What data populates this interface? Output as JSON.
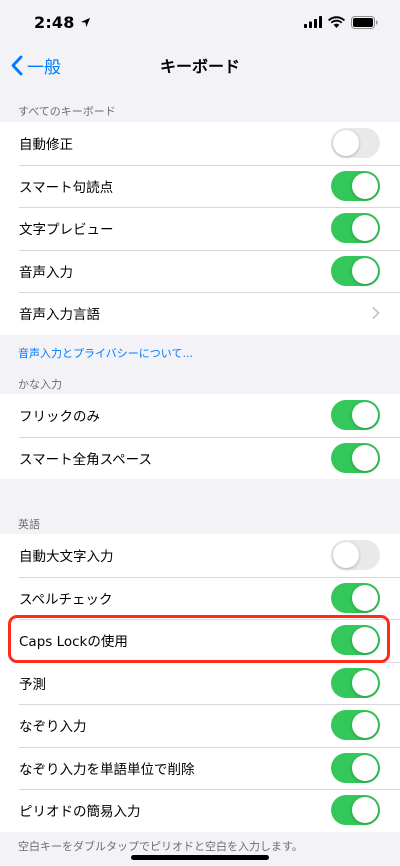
{
  "status": {
    "time": "2:48"
  },
  "nav": {
    "back_label": "一般",
    "title": "キーボード"
  },
  "sections": {
    "all_keyboards": {
      "header": "すべてのキーボード",
      "rows": [
        {
          "label": "自動修正",
          "on": false
        },
        {
          "label": "スマート句読点",
          "on": true
        },
        {
          "label": "文字プレビュー",
          "on": true
        },
        {
          "label": "音声入力",
          "on": true
        },
        {
          "label": "音声入力言語"
        }
      ],
      "footer_link": "音声入力とプライバシーについて..."
    },
    "kana": {
      "header": "かな入力",
      "rows": [
        {
          "label": "フリックのみ",
          "on": true
        },
        {
          "label": "スマート全角スペース",
          "on": true
        }
      ]
    },
    "english": {
      "header": "英語",
      "rows": [
        {
          "label": "自動大文字入力",
          "on": false
        },
        {
          "label": "スペルチェック",
          "on": true
        },
        {
          "label": "Caps Lockの使用",
          "on": true
        },
        {
          "label": "予測",
          "on": true
        },
        {
          "label": "なぞり入力",
          "on": true
        },
        {
          "label": "なぞり入力を単語単位で削除",
          "on": true
        },
        {
          "label": "ピリオドの簡易入力",
          "on": true
        }
      ],
      "footer": "空白キーをダブルタップでピリオドと空白を入力します。"
    }
  },
  "colors": {
    "accent": "#007aff",
    "toggle_on": "#34c759",
    "toggle_off": "#e9e9ea",
    "highlight": "#ff2d18"
  }
}
